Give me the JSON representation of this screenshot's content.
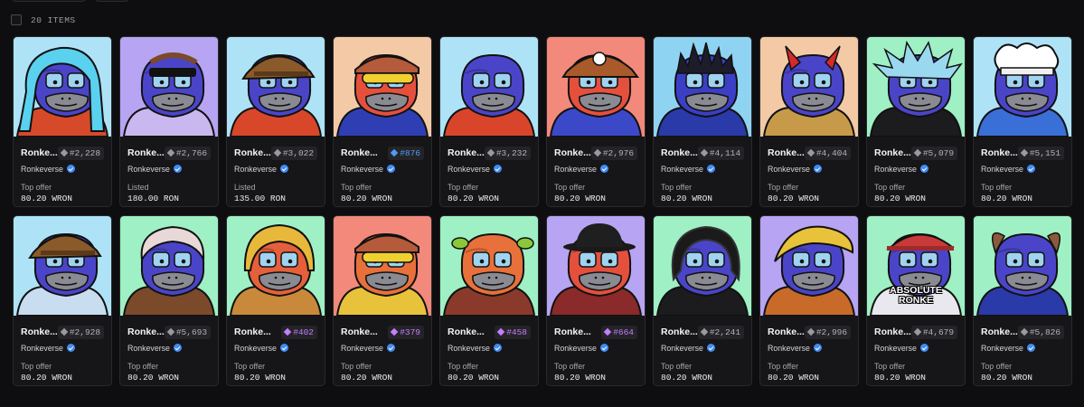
{
  "header": {
    "items_count": "20 ITEMS"
  },
  "items": [
    {
      "name": "Ronke...",
      "rank": "#2,228",
      "tier": "common",
      "collection": "Ronkeverse",
      "price_label": "Top offer",
      "price": "80.20 WRON",
      "bg": "#aee3f7",
      "fur": "#4a45c8",
      "hat": "bluehair",
      "cloth": "#d64a2a",
      "caption": ""
    },
    {
      "name": "Ronke...",
      "rank": "#2,766",
      "tier": "common",
      "collection": "Ronkeverse",
      "price_label": "Listed",
      "price": "180.00 RON",
      "bg": "#b7a4f2",
      "fur": "#4a45c8",
      "hat": "mask",
      "cloth": "#c9b8ef",
      "caption": ""
    },
    {
      "name": "Ronke...",
      "rank": "#3,022",
      "tier": "common",
      "collection": "Ronkeverse",
      "price_label": "Listed",
      "price": "135.00 RON",
      "bg": "#aee3f7",
      "fur": "#4a45c8",
      "hat": "helmet",
      "cloth": "#d8472a",
      "caption": ""
    },
    {
      "name": "Ronke...",
      "rank": "#876",
      "tier": "rare",
      "collection": "Ronkeverse",
      "price_label": "Top offer",
      "price": "80.20 WRON",
      "bg": "#f3c9a6",
      "fur": "#e5503d",
      "hat": "cap",
      "cloth": "#2f3fb3",
      "caption": ""
    },
    {
      "name": "Ronke...",
      "rank": "#3,232",
      "tier": "common",
      "collection": "Ronkeverse",
      "price_label": "Top offer",
      "price": "80.20 WRON",
      "bg": "#aee3f7",
      "fur": "#4a45c8",
      "hat": "none",
      "cloth": "#d8452b",
      "caption": ""
    },
    {
      "name": "Ronke...",
      "rank": "#2,976",
      "tier": "common",
      "collection": "Ronkeverse",
      "price_label": "Top offer",
      "price": "80.20 WRON",
      "bg": "#f2897a",
      "fur": "#e5503d",
      "hat": "mario",
      "cloth": "#3b49c8",
      "caption": ""
    },
    {
      "name": "Ronke...",
      "rank": "#4,114",
      "tier": "common",
      "collection": "Ronkeverse",
      "price_label": "Top offer",
      "price": "80.20 WRON",
      "bg": "#8fd3f2",
      "fur": "#3b3fc6",
      "hat": "spikes",
      "cloth": "#2a3aa8",
      "caption": ""
    },
    {
      "name": "Ronke...",
      "rank": "#4,404",
      "tier": "common",
      "collection": "Ronkeverse",
      "price_label": "Top offer",
      "price": "80.20 WRON",
      "bg": "#f3c9a6",
      "fur": "#4a45c8",
      "hat": "horns",
      "cloth": "#c79a4a",
      "caption": ""
    },
    {
      "name": "Ronke...",
      "rank": "#5,079",
      "tier": "common",
      "collection": "Ronkeverse",
      "price_label": "Top offer",
      "price": "80.20 WRON",
      "bg": "#9ff0c4",
      "fur": "#4a45c8",
      "hat": "rick",
      "cloth": "#1c1c1f",
      "caption": ""
    },
    {
      "name": "Ronke...",
      "rank": "#5,151",
      "tier": "common",
      "collection": "Ronkeverse",
      "price_label": "Top offer",
      "price": "80.20 WRON",
      "bg": "#aee3f7",
      "fur": "#4a45c8",
      "hat": "chef",
      "cloth": "#3a6fd8",
      "caption": ""
    },
    {
      "name": "Ronke...",
      "rank": "#2,928",
      "tier": "common",
      "collection": "Ronkeverse",
      "price_label": "Top offer",
      "price": "80.20 WRON",
      "bg": "#aee3f7",
      "fur": "#4a45c8",
      "hat": "helmet",
      "cloth": "#c8ddf0",
      "caption": ""
    },
    {
      "name": "Ronke...",
      "rank": "#5,693",
      "tier": "common",
      "collection": "Ronkeverse",
      "price_label": "Top offer",
      "price": "80.20 WRON",
      "bg": "#9ff0c4",
      "fur": "#4a45c8",
      "hat": "wig",
      "cloth": "#7a4a2a",
      "caption": ""
    },
    {
      "name": "Ronke...",
      "rank": "#402",
      "tier": "mythic",
      "collection": "Ronkeverse",
      "price_label": "Top offer",
      "price": "80.20 WRON",
      "bg": "#9ff0c4",
      "fur": "#e5603a",
      "hat": "goldhelm",
      "cloth": "#c88a3a",
      "caption": ""
    },
    {
      "name": "Ronke...",
      "rank": "#379",
      "tier": "mythic",
      "collection": "Ronkeverse",
      "price_label": "Top offer",
      "price": "80.20 WRON",
      "bg": "#f2897a",
      "fur": "#e8703a",
      "hat": "cap",
      "cloth": "#e8c23a",
      "caption": ""
    },
    {
      "name": "Ronke...",
      "rank": "#458",
      "tier": "mythic",
      "collection": "Ronkeverse",
      "price_label": "Top offer",
      "price": "80.20 WRON",
      "bg": "#9ff0c4",
      "fur": "#e8703a",
      "hat": "ogre",
      "cloth": "#8a3a2a",
      "caption": ""
    },
    {
      "name": "Ronke...",
      "rank": "#664",
      "tier": "mythic",
      "collection": "Ronkeverse",
      "price_label": "Top offer",
      "price": "80.20 WRON",
      "bg": "#b7a4f2",
      "fur": "#e5503d",
      "hat": "bowler",
      "cloth": "#8a2a2a",
      "caption": ""
    },
    {
      "name": "Ronke...",
      "rank": "#2,241",
      "tier": "common",
      "collection": "Ronkeverse",
      "price_label": "Top offer",
      "price": "80.20 WRON",
      "bg": "#9ff0c4",
      "fur": "#4a45c8",
      "hat": "dreads",
      "cloth": "#1c1c1f",
      "caption": ""
    },
    {
      "name": "Ronke...",
      "rank": "#2,996",
      "tier": "common",
      "collection": "Ronkeverse",
      "price_label": "Top offer",
      "price": "80.20 WRON",
      "bg": "#b7a4f2",
      "fur": "#4a45c8",
      "hat": "blond",
      "cloth": "#c86a2a",
      "caption": ""
    },
    {
      "name": "Ronke...",
      "rank": "#4,679",
      "tier": "common",
      "collection": "Ronkeverse",
      "price_label": "Top offer",
      "price": "80.20 WRON",
      "bg": "#9ff0c4",
      "fur": "#4a45c8",
      "hat": "redcap",
      "cloth": "#e8e8ee",
      "caption": "ABSOLUTE\nRONKE"
    },
    {
      "name": "Ronke...",
      "rank": "#5,826",
      "tier": "common",
      "collection": "Ronkeverse",
      "price_label": "Top offer",
      "price": "80.20 WRON",
      "bg": "#9ff0c4",
      "fur": "#4a45c8",
      "hat": "dog",
      "cloth": "#2a3aa8",
      "caption": ""
    }
  ]
}
